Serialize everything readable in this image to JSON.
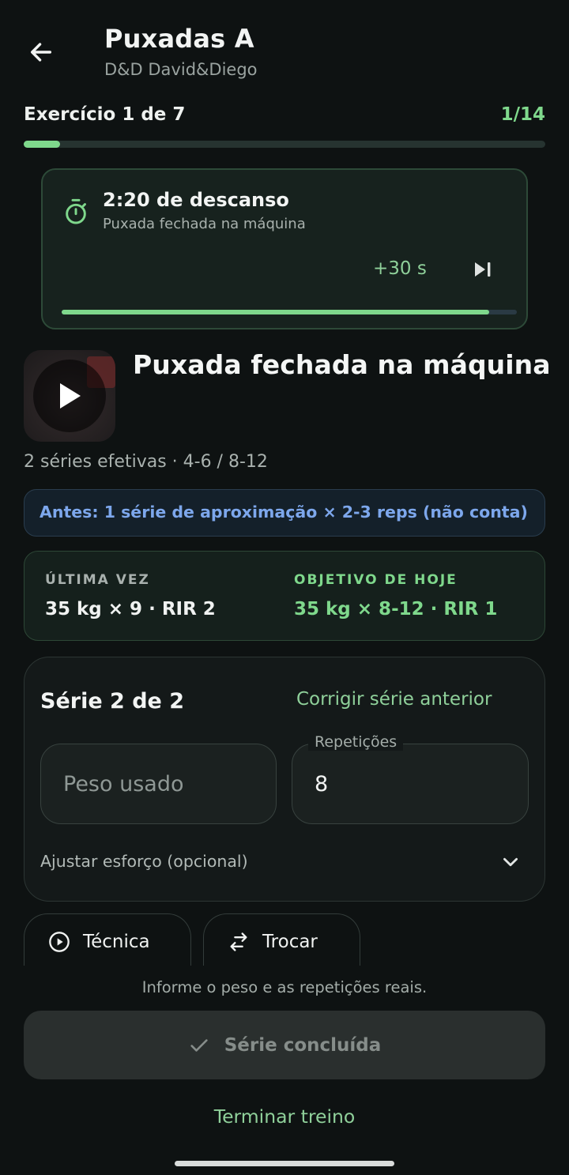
{
  "header": {
    "title": "Puxadas A",
    "subtitle": "D&D David&Diego",
    "back_icon": "arrow-left-icon"
  },
  "progress": {
    "label": "Exercício 1 de 7",
    "count": "1/14",
    "fraction": 0.07
  },
  "rest": {
    "title": "2:20 de descanso",
    "exercise": "Puxada fechada na máquina",
    "add_time_label": "+30 s",
    "timer_icon": "timer-icon",
    "skip_icon": "skip-next-icon",
    "remaining_fraction": 0.94
  },
  "exercise": {
    "name": "Puxada fechada na máquina",
    "series_info": "2 séries efetivas · 4-6 / 8-12",
    "warmup_note": "Antes: 1 série de aproximação × 2-3 reps (não conta)"
  },
  "comparison": {
    "last_label": "ÚLTIMA VEZ",
    "last_value": "35 kg × 9 · RIR 2",
    "goal_label": "OBJETIVO DE HOJE",
    "goal_value": "35 kg × 8-12 · RIR 1"
  },
  "set": {
    "title": "Série 2 de 2",
    "fix_previous_label": "Corrigir série anterior",
    "weight_placeholder": "Peso usado",
    "weight_value": "",
    "reps_label": "Repetições",
    "reps_value": "8",
    "effort_label": "Ajustar esforço (opcional)"
  },
  "actions": {
    "technique_label": "Técnica",
    "swap_label": "Trocar"
  },
  "footer": {
    "hint": "Informe o peso e as repetições reais.",
    "done_label": "Série concluída",
    "finish_label": "Terminar treino"
  },
  "colors": {
    "accent": "#7fd88c",
    "background": "#0e1212",
    "info_blue": "#7da7ec"
  }
}
